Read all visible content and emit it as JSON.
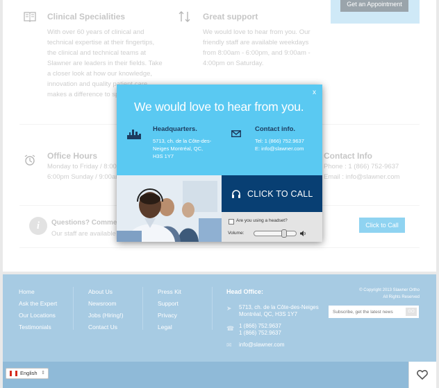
{
  "page": {
    "appointment_button": "Get an Appointment",
    "features": [
      {
        "title": "Clinical Specialities",
        "icon": "book-icon",
        "text": "With over 60 years of clinical and technical expertise at their fingertips, the clinical and technical teams at Slawner are leaders in their fields. Take a closer look at how our knowledge, innovation and quality patient care makes a difference to specialist orthotics."
      },
      {
        "title": "Great support",
        "icon": "sort-arrows-icon",
        "text": "We would love to hear from you. Our friendly staff are available weekdays from 8:00am - 6:00pm, and 9:00am - 4:00pm on Saturday."
      },
      {
        "title": "Office Hours",
        "icon": "alarm-clock-icon",
        "lines": [
          "Monday to Friday / 8:00a",
          "6:00pm Sunday / 9:00am -"
        ]
      },
      {
        "title": "Contact Info",
        "lines": [
          "Phone : 1 (866) 752-9637",
          "Email : info@slawner.com"
        ]
      }
    ],
    "questions": {
      "title": "Questions? Comments?",
      "text": "Our staff are available w"
    },
    "call_button": "Click to Call"
  },
  "modal": {
    "close": "x",
    "headline": "We would love to hear from you.",
    "hq": {
      "title": "Headquarters.",
      "lines": [
        "5713, ch. de la Côte-des-",
        "Neiges Montréal, QC,",
        "H3S 1Y7"
      ]
    },
    "contact": {
      "title": "Contact info.",
      "tel": "Tel: 1 (866) 752.9637",
      "email": "E: info@slawner.com"
    },
    "cta": "CLICK TO CALL",
    "headset_label": "Are you using a headset?",
    "headset_checked": false,
    "volume_label": "Volume:",
    "volume_level": 0.75
  },
  "footer": {
    "col1": [
      "Home",
      "Ask the Expert",
      "Our Locations",
      "Testimonials"
    ],
    "col2": [
      "About Us",
      "Newsroom",
      "Jobs (Hiring!)",
      "Contact Us"
    ],
    "col3": [
      "Press Kit",
      "Support",
      "Privacy",
      "Legal"
    ],
    "head_office_title": "Head Office:",
    "address": [
      "5713, ch. de la Côte-des-Neiges",
      "Montréal, QC, H3S 1Y7"
    ],
    "phones": [
      "1 (866) 752.9637",
      "1 (866) 752.9637"
    ],
    "email": "info@slawner.com",
    "copyright": [
      "© Copyright 2013 Slawner Ortho",
      "All Rights Reserved"
    ],
    "newsletter_placeholder": "Subscribe, get the latest news",
    "newsletter_submit": "GO"
  },
  "bottom_bar": {
    "language": "English",
    "wishlist_icon": "heart-icon"
  },
  "colors": {
    "modal_blue": "#5ac9f2",
    "cta_navy": "#083f73",
    "footer_blue": "#a7cbe3"
  }
}
